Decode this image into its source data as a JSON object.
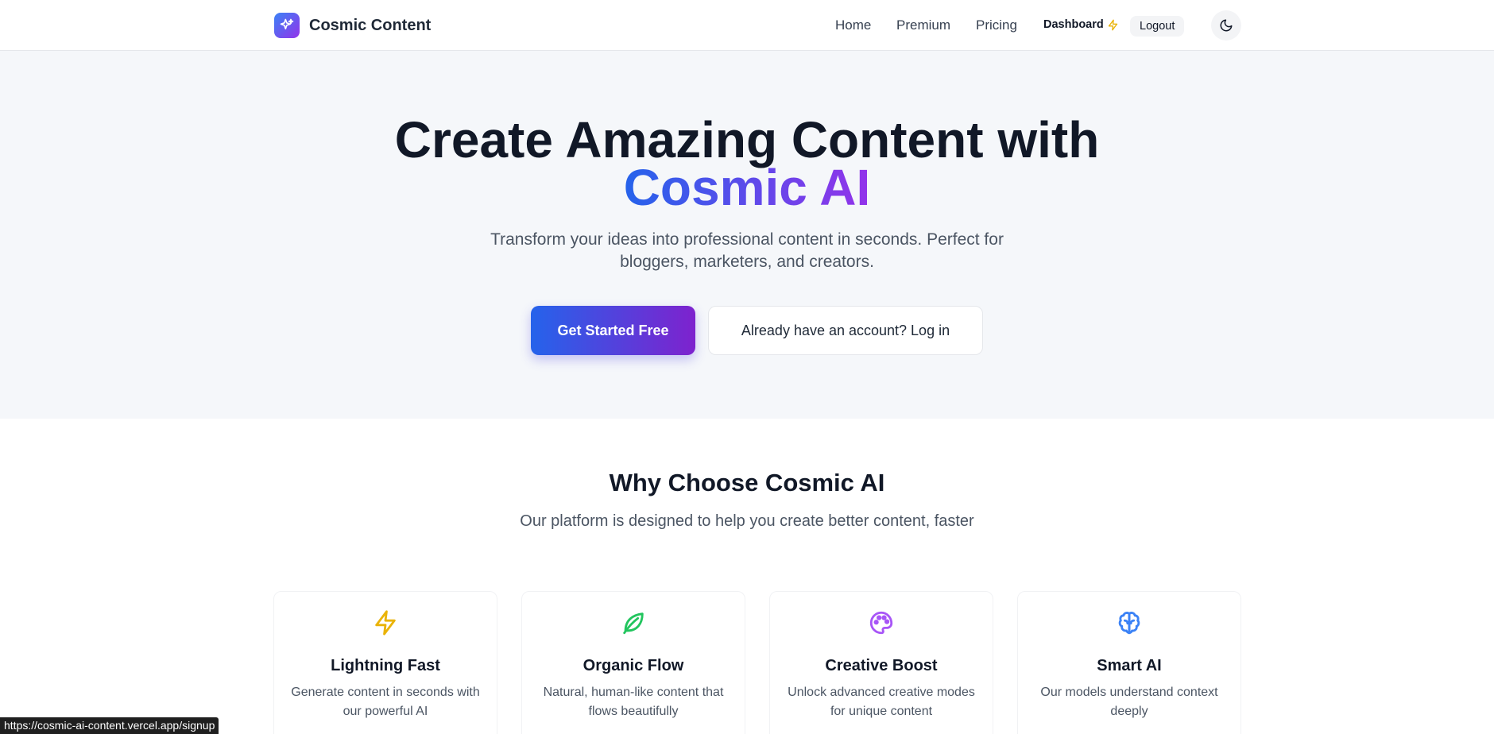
{
  "navbar": {
    "brand": "Cosmic Content",
    "links": {
      "home": "Home",
      "premium": "Premium",
      "pricing": "Pricing"
    },
    "dashboard": "Dashboard",
    "logout": "Logout",
    "theme_toggle_icon": "moon-icon"
  },
  "hero": {
    "title_line1": "Create Amazing Content with",
    "title_highlight": "Cosmic AI",
    "subtitle_line1": "Transform your ideas into professional content in seconds. Perfect for",
    "subtitle_line2": "bloggers, marketers, and creators.",
    "primary_cta": "Get Started Free",
    "secondary_cta": "Already have an account? Log in"
  },
  "features": {
    "title": "Why Choose Cosmic AI",
    "subtitle": "Our platform is designed to help you create better content, faster",
    "cards": [
      {
        "icon": "lightning-icon",
        "title": "Lightning Fast",
        "desc": "Generate content in seconds with our powerful AI",
        "color": "#eab308"
      },
      {
        "icon": "leaf-icon",
        "title": "Organic Flow",
        "desc": "Natural, human-like content that flows beautifully",
        "color": "#22c55e"
      },
      {
        "icon": "palette-icon",
        "title": "Creative Boost",
        "desc": "Unlock advanced creative modes for unique content",
        "color": "#a855f7"
      },
      {
        "icon": "brain-icon",
        "title": "Smart AI",
        "desc": "Our models understand context deeply",
        "color": "#3b82f6"
      }
    ]
  },
  "status_bar": {
    "url": "https://cosmic-ai-content.vercel.app/signup"
  },
  "colors": {
    "accent_blue": "#2563eb",
    "accent_purple": "#9333ea"
  }
}
